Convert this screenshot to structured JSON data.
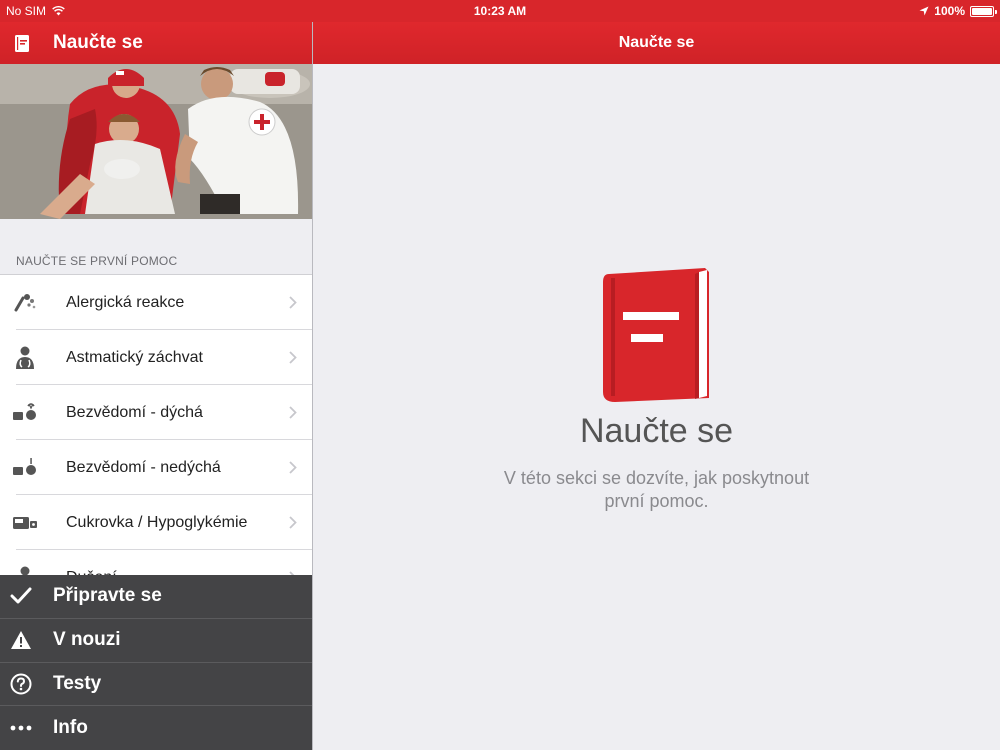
{
  "status": {
    "carrier": "No SIM",
    "time": "10:23 AM",
    "battery": "100%"
  },
  "sidebar": {
    "title": "Naučte se",
    "section_title": "NAUČTE SE PRVNÍ POMOC",
    "items": [
      {
        "label": "Alergická reakce",
        "icon": "allergy-icon"
      },
      {
        "label": "Astmatický záchvat",
        "icon": "asthma-icon"
      },
      {
        "label": "Bezvědomí - dýchá",
        "icon": "unconscious-breathing-icon"
      },
      {
        "label": "Bezvědomí - nedýchá",
        "icon": "unconscious-not-breathing-icon"
      },
      {
        "label": "Cukrovka / Hypoglykémie",
        "icon": "diabetes-icon"
      },
      {
        "label": "Dušení",
        "icon": "choking-icon"
      }
    ]
  },
  "tabbar": {
    "items": [
      {
        "label": "Připravte se",
        "icon": "checkmark-icon"
      },
      {
        "label": "V nouzi",
        "icon": "warning-icon"
      },
      {
        "label": "Testy",
        "icon": "question-icon"
      },
      {
        "label": "Info",
        "icon": "more-icon"
      }
    ]
  },
  "main": {
    "header_title": "Naučte se",
    "title": "Naučte se",
    "description": "V této sekci se dozvíte, jak poskytnout první pomoc."
  },
  "colors": {
    "brand_red": "#d8262b",
    "tabbar_bg": "#444446"
  }
}
